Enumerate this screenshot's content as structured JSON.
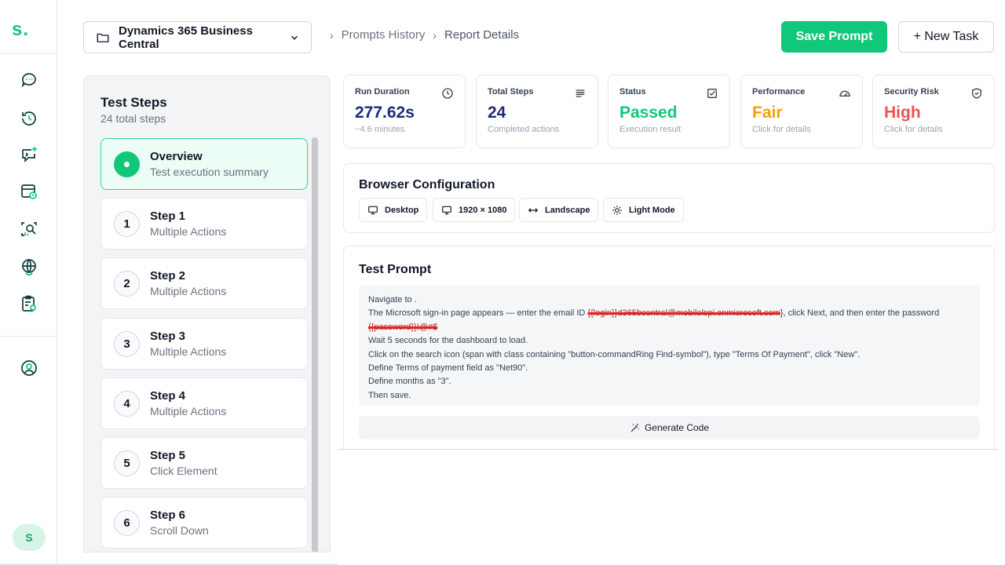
{
  "app": {
    "logo": "s."
  },
  "sidebar": {
    "items": [
      {
        "icon": "chat-icon"
      },
      {
        "icon": "history-icon"
      },
      {
        "icon": "new-chat-icon"
      },
      {
        "icon": "schedule-icon"
      },
      {
        "icon": "analytics-search-icon"
      },
      {
        "icon": "globe-icon"
      },
      {
        "icon": "clipboard-settings-icon"
      },
      {
        "icon": "user-circle-icon"
      }
    ],
    "avatar_letter": "S"
  },
  "header": {
    "project": "Dynamics 365 Business Central",
    "breadcrumb": [
      "Prompts History",
      "Report Details"
    ],
    "save_label": "Save Prompt",
    "new_label": "+ New Task"
  },
  "steps": {
    "title": "Test Steps",
    "subtitle": "24 total steps",
    "items": [
      {
        "num": "",
        "name": "Overview",
        "desc": "Test execution summary"
      },
      {
        "num": "1",
        "name": "Step 1",
        "desc": "Multiple Actions"
      },
      {
        "num": "2",
        "name": "Step 2",
        "desc": "Multiple Actions"
      },
      {
        "num": "3",
        "name": "Step 3",
        "desc": "Multiple Actions"
      },
      {
        "num": "4",
        "name": "Step 4",
        "desc": "Multiple Actions"
      },
      {
        "num": "5",
        "name": "Step 5",
        "desc": "Click Element"
      },
      {
        "num": "6",
        "name": "Step 6",
        "desc": "Scroll Down"
      }
    ]
  },
  "stats": [
    {
      "label": "Run Duration",
      "value": "277.62s",
      "sub": "~4.6 minutes",
      "color": "#1e2a78",
      "icon": "clock-icon"
    },
    {
      "label": "Total Steps",
      "value": "24",
      "sub": "Completed actions",
      "color": "#1e2a78",
      "icon": "list-icon"
    },
    {
      "label": "Status",
      "value": "Passed",
      "sub": "Execution result",
      "color": "#10c77a",
      "icon": "checkbox-icon"
    },
    {
      "label": "Performance",
      "value": "Fair",
      "sub": "Click for details",
      "color": "#f59e0b",
      "icon": "gauge-icon"
    },
    {
      "label": "Security Risk",
      "value": "High",
      "sub": "Click for details",
      "color": "#f05252",
      "icon": "shield-icon"
    }
  ],
  "browser": {
    "title": "Browser Configuration",
    "chips": [
      {
        "label": "Desktop",
        "icon": "monitor-icon"
      },
      {
        "label": "1920 × 1080",
        "icon": "monitor-icon"
      },
      {
        "label": "Landscape",
        "icon": "arrows-horizontal-icon"
      },
      {
        "label": "Light Mode",
        "icon": "sun-icon"
      }
    ]
  },
  "prompt": {
    "title": "Test Prompt",
    "line1": "Navigate to .",
    "line2_a": "The Microsoft sign-in page appears — enter the email ID ",
    "line2_redacted": "{{login}}d365bcentral@mobilelspi.onmicrosoft.com",
    "line2_b": "}, click Next, and then enter the password",
    "line3_redacted": "{{password}}!@#$",
    "line4": "Wait 5 seconds for the dashboard to load.",
    "line5": "Click on the search icon (span with class containing \"button-commandRing Find-symbol\"), type \"Terms Of Payment\", click \"New\".",
    "line6": "Define Terms of payment field as \"Net90\".",
    "line7": "Define months as \"3\".",
    "line8": "Then save.",
    "generate_label": "Generate Code"
  },
  "colors": {
    "accent": "#10c77a",
    "danger": "#f05252",
    "warn": "#f59e0b",
    "navy": "#1e2a78"
  }
}
